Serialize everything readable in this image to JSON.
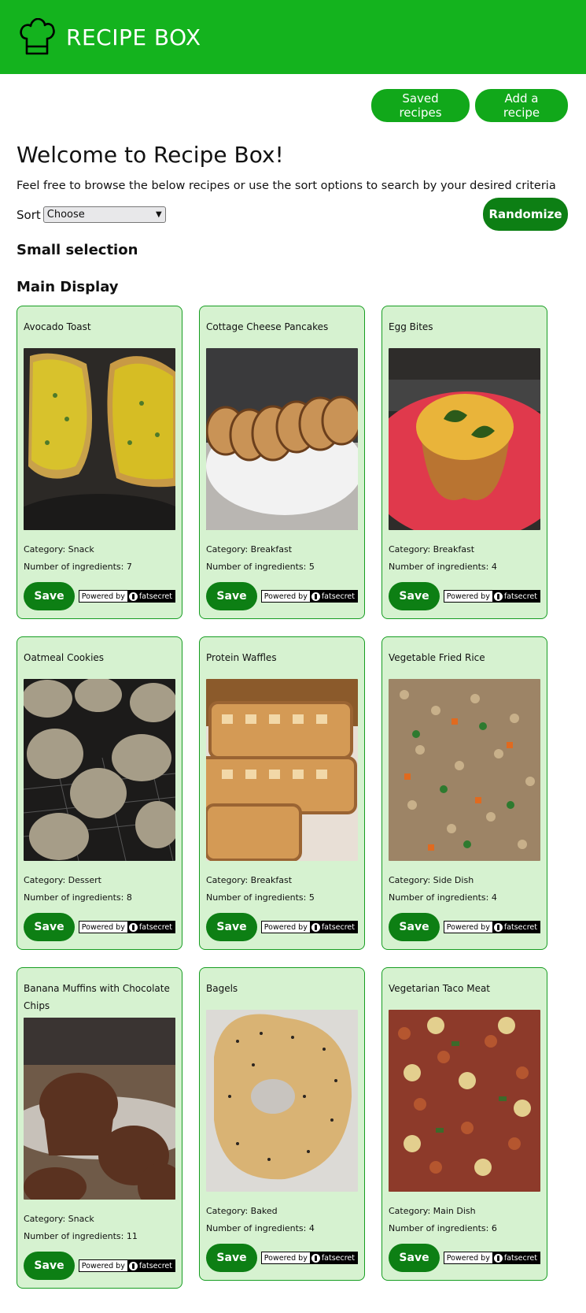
{
  "header": {
    "title": "RECIPE BOX"
  },
  "actions": {
    "saved": "Saved recipes",
    "add": "Add a recipe",
    "randomize": "Randomize"
  },
  "welcome": {
    "heading": "Welcome to Recipe Box!",
    "intro": "Feel free to browse the below recipes or use the sort options to search by your desired criteria"
  },
  "sort": {
    "label": "Sort",
    "selected": "Choose"
  },
  "sections": {
    "small": "Small selection",
    "main": "Main Display"
  },
  "powered": {
    "by": "Powered by",
    "brand": "fatsecret"
  },
  "save_label": "Save",
  "recipes": [
    {
      "name": "Avocado Toast",
      "category": "Category: Snack",
      "ingredients": "Number of ingredients: 7"
    },
    {
      "name": "Cottage Cheese Pancakes",
      "category": "Category: Breakfast",
      "ingredients": "Number of ingredients: 5"
    },
    {
      "name": "Egg Bites",
      "category": "Category: Breakfast",
      "ingredients": "Number of ingredients: 4"
    },
    {
      "name": "Oatmeal Cookies",
      "category": "Category: Dessert",
      "ingredients": "Number of ingredients: 8"
    },
    {
      "name": "Protein Waffles",
      "category": "Category: Breakfast",
      "ingredients": "Number of ingredients: 5"
    },
    {
      "name": "Vegetable Fried Rice",
      "category": "Category: Side Dish",
      "ingredients": "Number of ingredients: 4"
    },
    {
      "name": "Banana Muffins with Chocolate Chips",
      "category": "Category: Snack",
      "ingredients": "Number of ingredients: 11"
    },
    {
      "name": "Bagels",
      "category": "Category: Baked",
      "ingredients": "Number of ingredients: 4"
    },
    {
      "name": "Vegetarian Taco Meat",
      "category": "Category: Main Dish",
      "ingredients": "Number of ingredients: 6"
    }
  ],
  "colors": {
    "header": "#14b31e",
    "button": "#11a81a",
    "save": "#0d7f14",
    "card_bg": "#d6f2d0",
    "card_border": "#179d22"
  }
}
